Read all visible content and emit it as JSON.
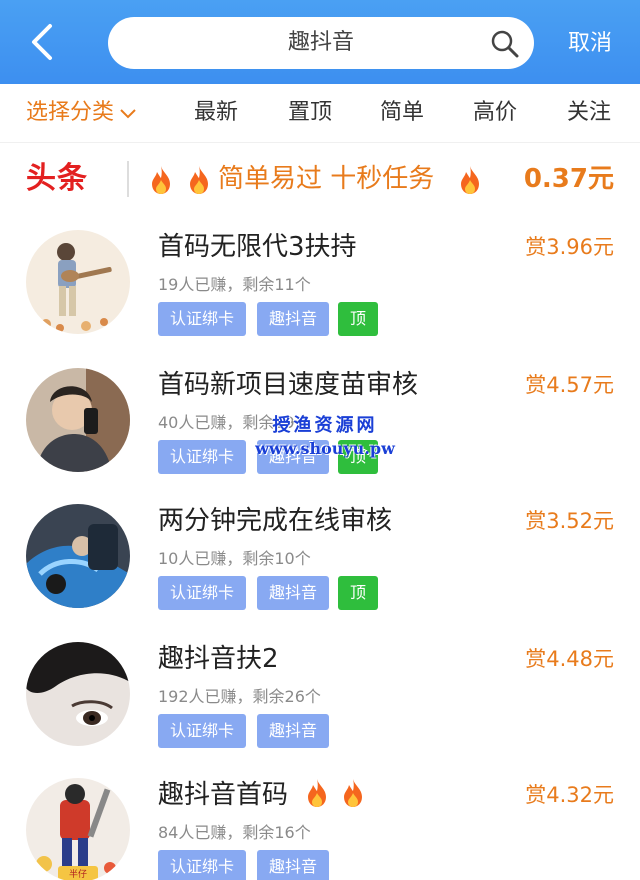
{
  "header": {
    "search_text": "趣抖音",
    "cancel_label": "取消"
  },
  "tabs": [
    {
      "label": "选择分类",
      "active": true,
      "has_dropdown": true
    },
    {
      "label": "最新"
    },
    {
      "label": "置顶"
    },
    {
      "label": "简单"
    },
    {
      "label": "高价"
    },
    {
      "label": "关注"
    }
  ],
  "headline": {
    "tag": "头条",
    "text": "简单易过 十秒任务",
    "price": "0.37元"
  },
  "tasks": [
    {
      "title": "首码无限代3扶持",
      "reward": "赏3.96元",
      "stats": "19人已赚，剩余11个",
      "tags": [
        "认证绑卡",
        "趣抖音"
      ],
      "pin": "顶"
    },
    {
      "title": "首码新项目速度苗审核",
      "reward": "赏4.57元",
      "stats": "40人已赚，剩余59个",
      "tags": [
        "认证绑卡",
        "趣抖音"
      ],
      "pin": "顶"
    },
    {
      "title": "两分钟完成在线审核",
      "reward": "赏3.52元",
      "stats": "10人已赚，剩余10个",
      "tags": [
        "认证绑卡",
        "趣抖音"
      ],
      "pin": "顶"
    },
    {
      "title": "趣抖音扶2",
      "reward": "赏4.48元",
      "stats": "192人已赚，剩余26个",
      "tags": [
        "认证绑卡",
        "趣抖音"
      ]
    },
    {
      "title": "趣抖音首码",
      "reward": "赏4.32元",
      "stats": "84人已赚，剩余16个",
      "tags": [
        "认证绑卡",
        "趣抖音"
      ],
      "avatar_badge": "半仔"
    }
  ],
  "watermark": {
    "line1": "授渔资源网",
    "line2": "www.shouyu.pw"
  },
  "colors": {
    "header_blue": "#3d8ff0",
    "accent_orange": "#e87b1c",
    "headline_red": "#e32020",
    "tag_blue": "#88a9f2",
    "pin_green": "#2fbe3d"
  }
}
